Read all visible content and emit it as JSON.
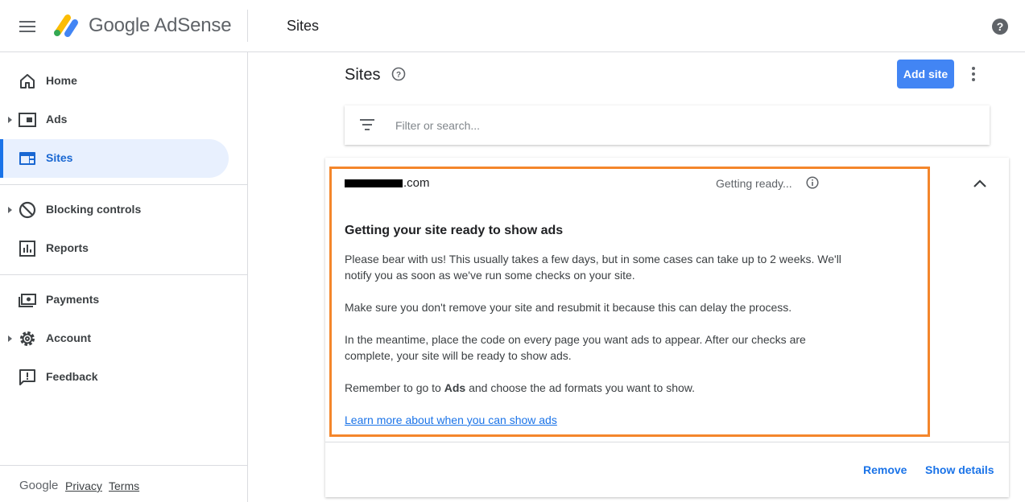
{
  "header": {
    "brand": "Google AdSense",
    "page_title": "Sites",
    "icons": [
      "menu-icon",
      "adsense-logo",
      "help-icon"
    ]
  },
  "sidebar": {
    "items": [
      {
        "label": "Home",
        "icon": "home-icon",
        "expandable": false,
        "active": false
      },
      {
        "label": "Ads",
        "icon": "ads-icon",
        "expandable": true,
        "active": false
      },
      {
        "label": "Sites",
        "icon": "sites-icon",
        "expandable": false,
        "active": true
      },
      {
        "label": "Blocking controls",
        "icon": "block-icon",
        "expandable": true,
        "active": false
      },
      {
        "label": "Reports",
        "icon": "reports-icon",
        "expandable": false,
        "active": false
      },
      {
        "label": "Payments",
        "icon": "payments-icon",
        "expandable": false,
        "active": false
      },
      {
        "label": "Account",
        "icon": "gear-icon",
        "expandable": true,
        "active": false
      },
      {
        "label": "Feedback",
        "icon": "feedback-icon",
        "expandable": false,
        "active": false
      }
    ],
    "footer": {
      "google": "Google",
      "privacy": "Privacy",
      "terms": "Terms"
    }
  },
  "main": {
    "title": "Sites",
    "add_button": "Add site",
    "filter": {
      "placeholder": "Filter or search...",
      "value": ""
    },
    "site": {
      "domain_suffix": ".com",
      "status": "Getting ready...",
      "heading": "Getting your site ready to show ads",
      "p1": "Please bear with us! This usually takes a few days, but in some cases can take up to 2 weeks. We'll notify you as soon as we've run some checks on your site.",
      "p2": "Make sure you don't remove your site and resubmit it because this can delay the process.",
      "p3": "In the meantime, place the code on every page you want ads to appear. After our checks are complete, your site will be ready to show ads.",
      "p4_before": "Remember to go to ",
      "p4_bold": "Ads",
      "p4_after": " and choose the ad formats you want to show.",
      "learn_more": "Learn more about when you can show ads",
      "remove": "Remove",
      "show_details": "Show details"
    }
  },
  "colors": {
    "accent": "#1a73e8",
    "button": "#4285f4",
    "active_bg": "#e8f0fe",
    "highlight": "#f4862b"
  }
}
